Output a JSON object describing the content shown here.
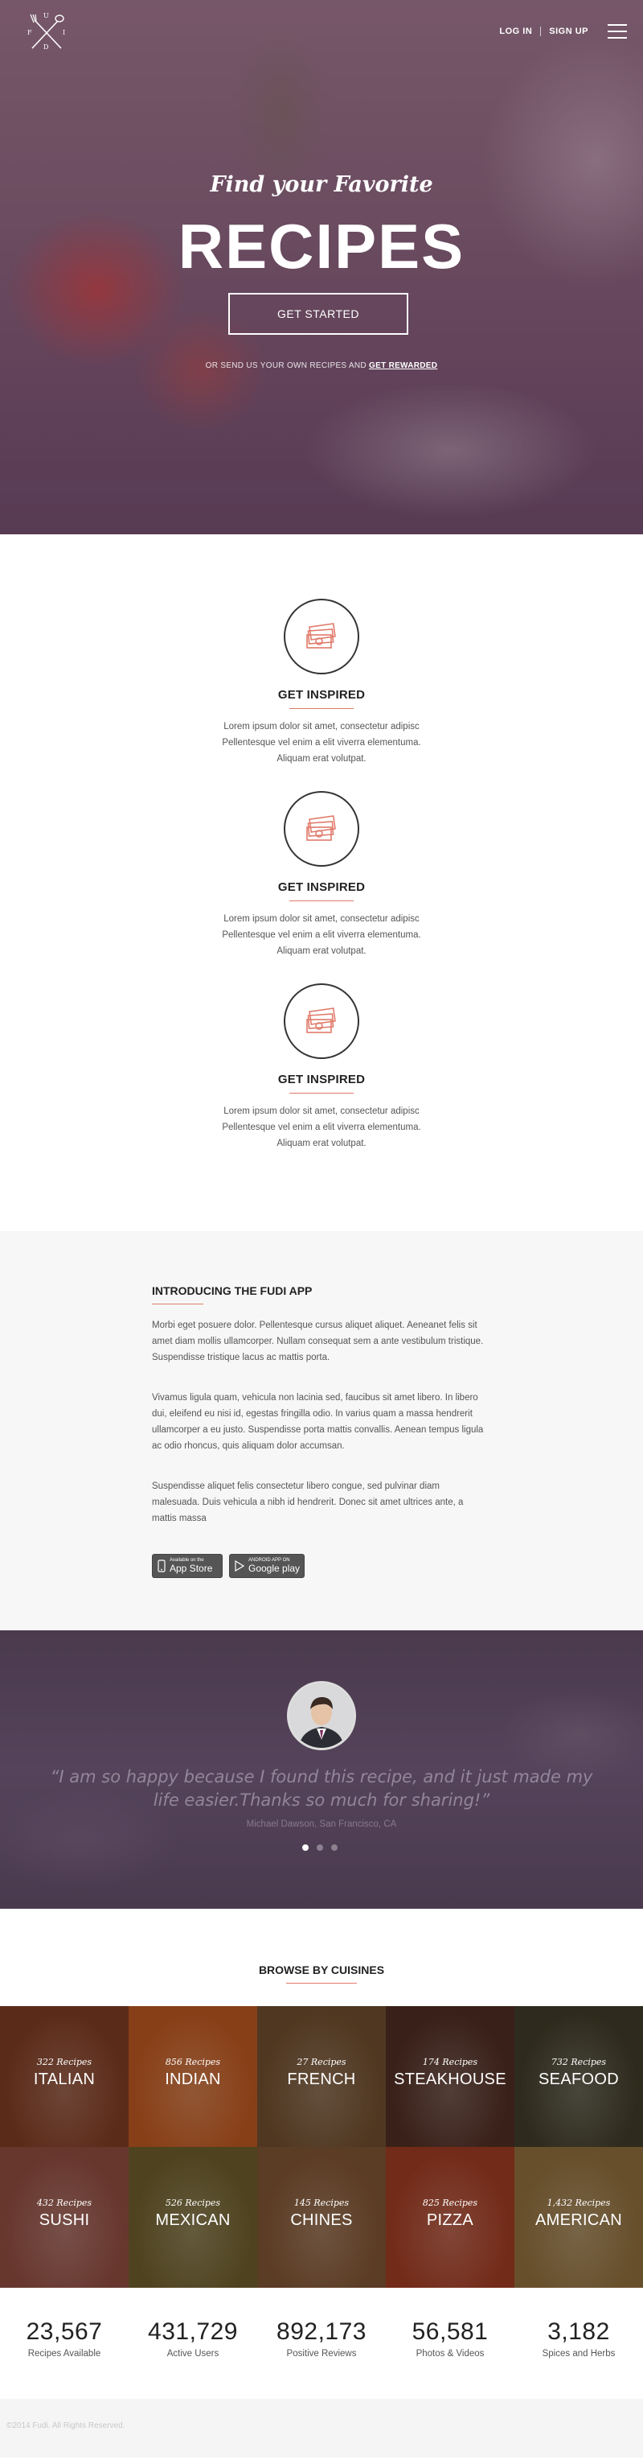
{
  "nav": {
    "login": "LOG IN",
    "signup": "SIGN UP"
  },
  "hero": {
    "subtitle": "Find your Favorite",
    "title": "RECIPES",
    "cta": "GET STARTED",
    "note_prefix": "OR SEND US YOUR OWN RECIPES AND",
    "note_link": "GET REWARDED"
  },
  "logo": {
    "letters": [
      "F",
      "U",
      "D",
      "I"
    ]
  },
  "features": [
    {
      "icon": "money-stack-icon",
      "title": "GET INSPIRED",
      "text": "Lorem ipsum dolor sit amet, consectetur adipisc Pellentesque vel enim a elit viverra elementuma. Aliquam erat volutpat."
    },
    {
      "icon": "money-stack-icon",
      "title": "GET INSPIRED",
      "text": "Lorem ipsum dolor sit amet, consectetur adipisc Pellentesque vel enim a elit viverra elementuma. Aliquam erat volutpat."
    },
    {
      "icon": "money-stack-icon",
      "title": "GET INSPIRED",
      "text": "Lorem ipsum dolor sit amet, consectetur adipisc Pellentesque vel enim a elit viverra elementuma. Aliquam erat volutpat."
    }
  ],
  "app": {
    "title": "INTRODUCING THE FUDI APP",
    "paragraphs": [
      "Morbi eget posuere dolor. Pellentesque cursus aliquet aliquet. Aeneanet felis sit amet diam mollis ullamcorper. Nullam consequat sem a ante vestibulum tristique. Suspendisse tristique lacus ac mattis porta.",
      "Vivamus ligula quam, vehicula non lacinia sed, faucibus sit amet libero. In libero dui, eleifend eu nisi id, egestas fringilla odio. In varius quam a massa hendrerit ullamcorper a eu justo. Suspendisse porta mattis convallis. Aenean tempus ligula ac odio rhoncus, quis aliquam dolor accumsan.",
      "Suspendisse aliquet felis consectetur libero congue, sed pulvinar diam malesuada. Duis vehicula a nibh id hendrerit. Donec sit amet ultrices ante, a mattis massa"
    ],
    "appstore_small": "Available on the",
    "appstore_big": "App Store",
    "googleplay_small": "ANDROID APP ON",
    "googleplay_big": "Google play"
  },
  "testimonial": {
    "quote": "“I am so happy because I found this recipe, and it just made my life easier.Thanks so much for sharing!”",
    "author": "Michael Dawson, San Francisco, CA"
  },
  "cuisines": {
    "title": "BROWSE BY CUISINES",
    "items": [
      {
        "count": "322 Recipes",
        "name": "ITALIAN",
        "color": "#7a3a22"
      },
      {
        "count": "856 Recipes",
        "name": "INDIAN",
        "color": "#b5551f"
      },
      {
        "count": "27 Recipes",
        "name": "FRENCH",
        "color": "#6b4a2c"
      },
      {
        "count": "174 Recipes",
        "name": "STEAKHOUSE",
        "color": "#4d2c22"
      },
      {
        "count": "732 Recipes",
        "name": "SEAFOOD",
        "color": "#3e3a28"
      },
      {
        "count": "432 Recipes",
        "name": "SUSHI",
        "color": "#8a4a3e"
      },
      {
        "count": "526 Recipes",
        "name": "MEXICAN",
        "color": "#6a5a2a"
      },
      {
        "count": "145 Recipes",
        "name": "CHINES",
        "color": "#7a5030"
      },
      {
        "count": "825 Recipes",
        "name": "PIZZA",
        "color": "#9a3a22"
      },
      {
        "count": "1,432 Recipes",
        "name": "AMERICAN",
        "color": "#8a6a3a"
      }
    ]
  },
  "stats": [
    {
      "value": "23,567",
      "label": "Recipes Available"
    },
    {
      "value": "431,729",
      "label": "Active Users"
    },
    {
      "value": "892,173",
      "label": "Positive Reviews"
    },
    {
      "value": "56,581",
      "label": "Photos & Videos"
    },
    {
      "value": "3,182",
      "label": "Spices and Herbs"
    }
  ],
  "footer": {
    "copyright": "©2014 Fudi. All Rights Reserved."
  }
}
